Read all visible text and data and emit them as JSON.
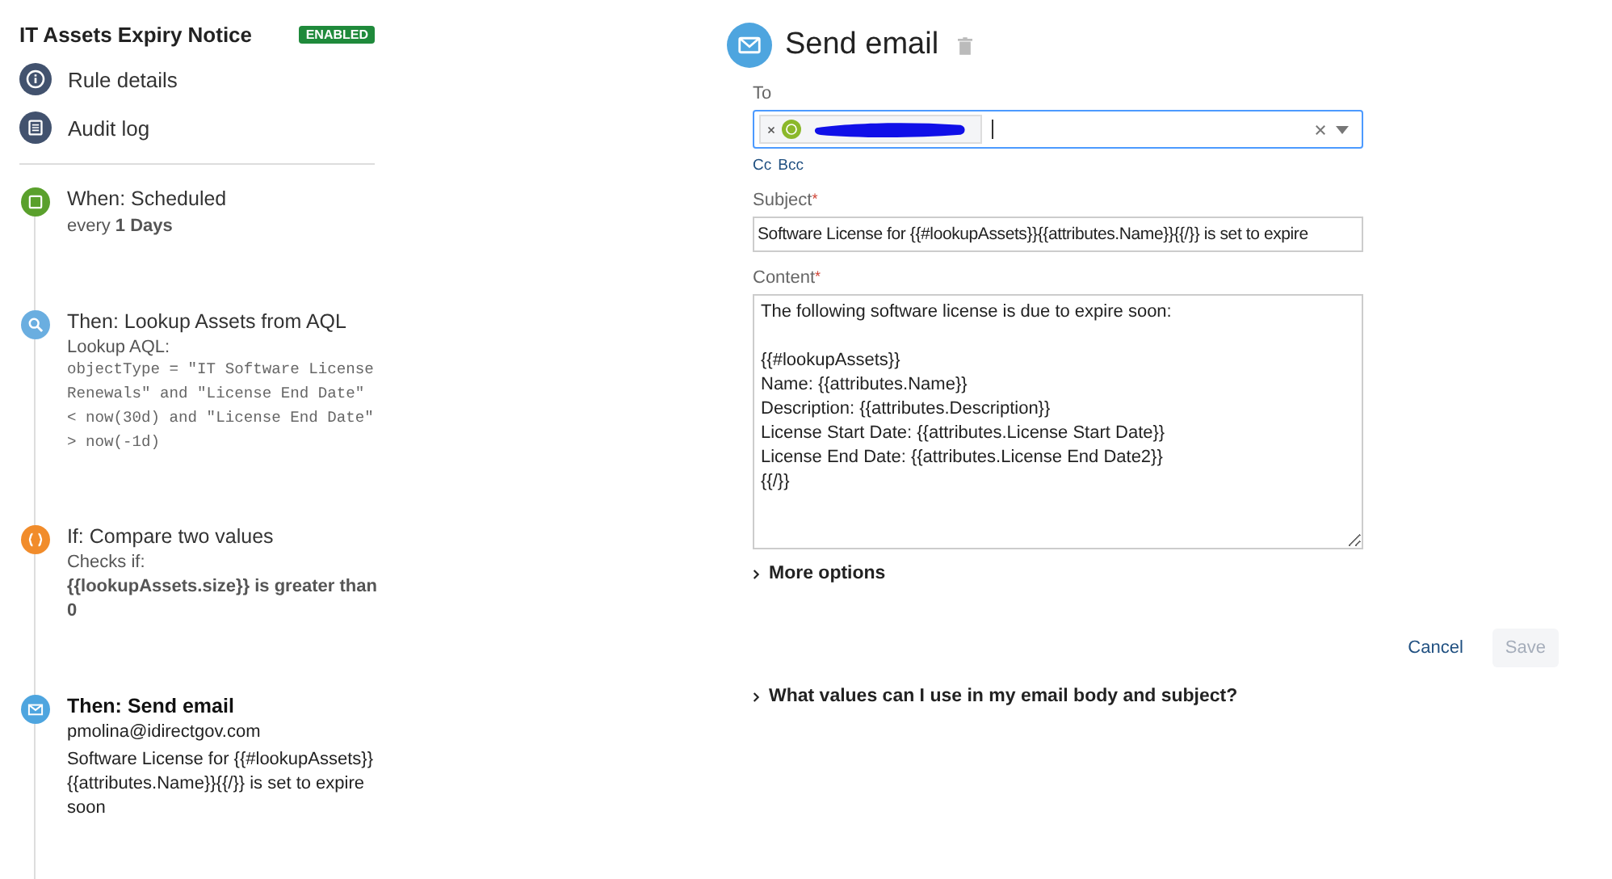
{
  "rule": {
    "title": "IT Assets Expiry Notice",
    "status": "ENABLED",
    "enabled": true
  },
  "nav": [
    {
      "kind": "info",
      "label": "Rule details"
    },
    {
      "kind": "log",
      "label": "Audit log"
    }
  ],
  "steps": [
    {
      "kind": "trigger",
      "title": "When: Scheduled",
      "selected": false,
      "lines": [
        {
          "kind": "text",
          "text": "every **1 Days**"
        }
      ]
    },
    {
      "kind": "lookup",
      "title": "Then: Lookup Assets from AQL",
      "selected": false,
      "lines": [
        {
          "kind": "label",
          "text": "Lookup AQL:"
        },
        {
          "kind": "code",
          "text": "objectType = \"IT Software License Renewals\" and \"License End Date\" < now(30d) and \"License End Date\" > now(-1d)"
        }
      ]
    },
    {
      "kind": "condition",
      "title": "If: Compare two values",
      "selected": false,
      "lines": [
        {
          "kind": "label",
          "text": "Checks if:"
        },
        {
          "kind": "strong",
          "text": "{{lookupAssets.size}} is greater than 0"
        }
      ]
    },
    {
      "kind": "email",
      "title": "Then: Send email",
      "selected": true,
      "lines": [
        {
          "kind": "text",
          "text": "pmolina@idirectgov.com"
        },
        {
          "kind": "text",
          "text": "Software License for {{#lookupAssets}} {{attributes.Name}}{{/}} is set to expire soon"
        }
      ]
    }
  ],
  "editor": {
    "title": "Send email",
    "to": {
      "label": "To",
      "recipients": [
        {
          "kind": "redacted"
        }
      ],
      "links": [
        "Cc",
        "Bcc"
      ]
    },
    "subject": {
      "label": "Subject",
      "required_mark": "*",
      "value": "Software License for {{#lookupAssets}}{{attributes.Name}}{{/}} is set to expire"
    },
    "content": {
      "label": "Content",
      "required_mark": "*",
      "value": "The following software license is due to expire soon:\n\n{{#lookupAssets}}\nName: {{attributes.Name}}\nDescription: {{attributes.Description}}\nLicense Start Date: {{attributes.License Start Date}}\nLicense End Date: {{attributes.License End Date2}}\n{{/}}"
    },
    "more_options": {
      "label": "More options",
      "expanded": false
    },
    "buttons": [
      {
        "kind": "link",
        "label": "Cancel",
        "disabled": false
      },
      {
        "kind": "primary",
        "label": "Save",
        "disabled": true
      }
    ],
    "help": {
      "label": "What values can I use in my email body and subject?",
      "expanded": false
    }
  }
}
